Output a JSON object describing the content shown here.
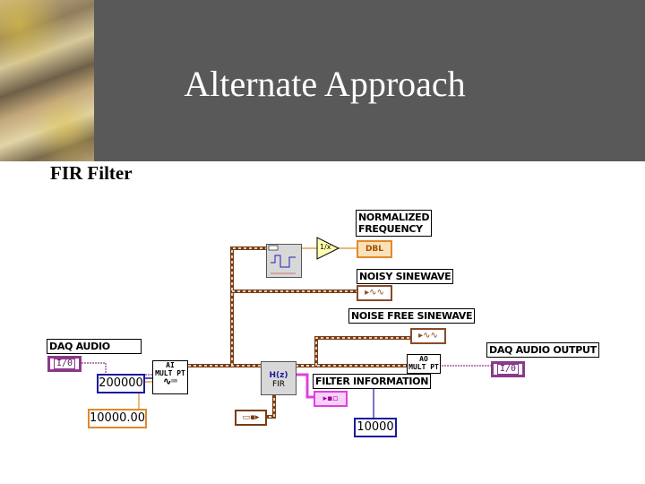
{
  "slide": {
    "title": "Alternate Approach",
    "subtitle": "FIR Filter"
  },
  "diagram": {
    "labels": {
      "normalized_frequency": "NORMALIZED\nFREQUENCY",
      "noisy_sinewave": "NOISY SINEWAVE",
      "noise_free_sinewave": "NOISE FREE SINEWAVE",
      "daq_audio": "DAQ AUDIO",
      "daq_audio_output": "DAQ AUDIO OUTPUT",
      "filter_information": "FILTER INFORMATION"
    },
    "terminals": {
      "dbl_indicator": "DBL",
      "io_in": "I/0",
      "io_out": "I/0",
      "samples_constant": "200000",
      "rate_constant": "10000.00",
      "filter_rate_constant": "10000"
    },
    "nodes": {
      "ai_mult_pt": "AI\nMULT PT",
      "ao_mult_pt": "AO\nMULT PT",
      "fir": "FIR",
      "reciprocal": "1/x"
    },
    "colors": {
      "banner": "#595959",
      "cluster_wire": "#7a3c14",
      "dbl_orange": "#e08a2a",
      "int_blue": "#1a1aa0",
      "io_purple": "#8a3a8a",
      "info_pink": "#e040e0"
    }
  }
}
